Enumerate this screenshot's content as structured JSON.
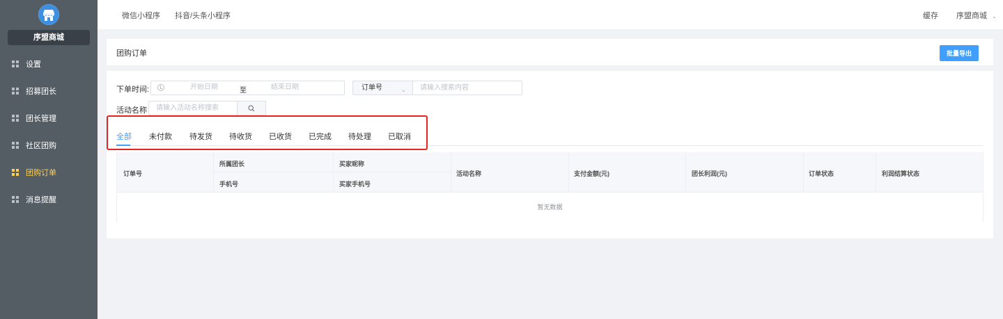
{
  "sidebar": {
    "store_name": "序盟商城",
    "items": [
      {
        "label": "设置"
      },
      {
        "label": "招募团长"
      },
      {
        "label": "团长管理"
      },
      {
        "label": "社区团购"
      },
      {
        "label": "团购订单"
      },
      {
        "label": "消息提醒"
      }
    ],
    "active_color": "#ffd04b"
  },
  "header": {
    "tabs": [
      "微信小程序",
      "抖音/头条小程序"
    ],
    "cache": "缓存",
    "user_menu": "序盟商城"
  },
  "page": {
    "title": "团购订单",
    "export_button": "批量导出"
  },
  "filters": {
    "order_time_label": "下单时间:",
    "start_placeholder": "开始日期",
    "range_separator": "至",
    "end_placeholder": "结束日期",
    "search_type": "订单号",
    "search_placeholder": "请输入搜索内容",
    "activity_label": "活动名称",
    "activity_placeholder": "请输入活动名称搜索"
  },
  "status_tabs": [
    "全部",
    "未付款",
    "待发货",
    "待收货",
    "已收货",
    "已完成",
    "待处理",
    "已取消"
  ],
  "table": {
    "headers": {
      "order_no": "订单号",
      "leader": "所属团长",
      "phone": "手机号",
      "buyer": "买家昵称",
      "buyer_phone": "买家手机号",
      "activity": "活动名称",
      "amount": "支付金额(元)",
      "profit": "团长利润(元)",
      "status": "订单状态",
      "settle": "利润结算状态"
    },
    "empty_text": "暂无数据"
  },
  "colors": {
    "primary": "#409eff",
    "sidebar": "#545c64",
    "highlight": "#e5231f"
  }
}
